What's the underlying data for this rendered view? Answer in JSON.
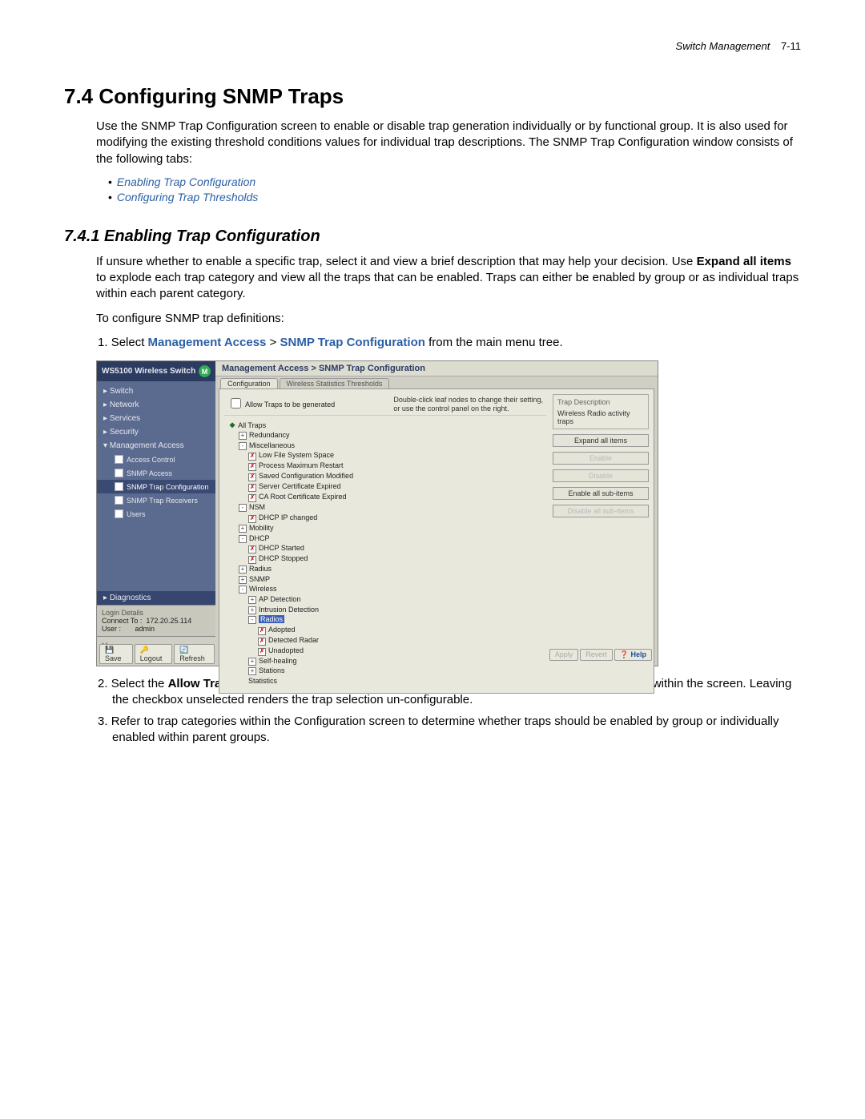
{
  "header": {
    "book": "Switch Management",
    "page": "7-11"
  },
  "section": {
    "number": "7.4",
    "title": "Configuring SNMP Traps"
  },
  "intro": "Use the SNMP Trap Configuration screen to enable or disable trap generation individually or by functional group. It is also used for modifying the existing threshold conditions values for individual trap descriptions. The SNMP Trap Configuration window consists of the following tabs:",
  "bullets": [
    "Enabling Trap Configuration",
    "Configuring Trap Thresholds"
  ],
  "subsection": {
    "number": "7.4.1",
    "title": "Enabling Trap Configuration"
  },
  "sub_intro": {
    "pre": "If unsure whether to enable a specific trap, select it and view a brief description that may help your decision. Use ",
    "emph": "Expand all items",
    "post": " to explode each trap category and view all the traps that can be enabled. Traps can either be enabled by group or as individual traps within each parent category."
  },
  "to_configure": "To configure SNMP trap definitions:",
  "steps": {
    "s1": {
      "num": "1.",
      "pre": "Select ",
      "path1": "Management Access",
      "gt": " > ",
      "path2": "SNMP Trap Configuration",
      "post": " from the main menu tree."
    },
    "s2": {
      "num": "2.",
      "pre": "Select the ",
      "emph": "Allow Traps to be generated",
      "post": " checkbox to enable the selection (and employment) of traps within the screen. Leaving the checkbox unselected renders the trap selection un-configurable."
    },
    "s3": {
      "num": "3.",
      "text": "Refer to trap categories within the Configuration screen to determine whether traps should be enabled by group or individually enabled within parent groups."
    }
  },
  "app": {
    "product": "WS5100 Wireless Switch",
    "logo_letter": "M",
    "breadcrumb": "Management Access > SNMP Trap Configuration",
    "tabs": {
      "active": "Configuration",
      "inactive": "Wireless Statistics Thresholds"
    },
    "nav": {
      "switch": "Switch",
      "network": "Network",
      "services": "Services",
      "security": "Security",
      "management": "Management Access",
      "sub": {
        "access_control": "Access Control",
        "snmp_access": "SNMP Access",
        "snmp_trap_config": "SNMP Trap Configuration",
        "snmp_trap_receivers": "SNMP Trap Receivers",
        "users": "Users"
      },
      "diagnostics": "Diagnostics"
    },
    "login": {
      "title": "Login Details",
      "connect_label": "Connect To :",
      "connect_value": "172.20.25.114",
      "user_label": "User :",
      "user_value": "admin"
    },
    "message_label": "Message",
    "toolbar": {
      "save": "Save",
      "logout": "Logout",
      "refresh": "Refresh"
    },
    "content_buttons": {
      "apply": "Apply",
      "revert": "Revert",
      "help": "Help"
    },
    "allow_traps": "Allow Traps to be generated",
    "hint1": "Double-click leaf nodes to change their setting,",
    "hint2": "or use the control panel on the right.",
    "tree": {
      "all": "All Traps",
      "redundancy": "Redundancy",
      "misc": "Miscellaneous",
      "misc_low": "Low File System Space",
      "misc_proc": "Process Maximum Restart",
      "misc_saved": "Saved Configuration Modified",
      "misc_server": "Server Certificate Expired",
      "misc_ca": "CA Root Certificate Expired",
      "nsm": "NSM",
      "nsm_dhcp": "DHCP IP changed",
      "mobility": "Mobility",
      "dhcp": "DHCP",
      "dhcp_start": "DHCP Started",
      "dhcp_stop": "DHCP Stopped",
      "radius": "Radius",
      "snmp": "SNMP",
      "wireless": "Wireless",
      "ap_detection": "AP Detection",
      "intrusion": "Intrusion Detection",
      "radios": "Radios",
      "radios_adopted": "Adopted",
      "radios_detected": "Detected Radar",
      "radios_unadopted": "Unadopted",
      "self_healing": "Self-healing",
      "stations": "Stations",
      "statistics": "Statistics"
    },
    "right": {
      "desc_title": "Trap Description",
      "desc_text": "Wireless Radio activity traps",
      "expand": "Expand all items",
      "enable": "Enable",
      "disable": "Disable",
      "enable_all": "Enable all sub-items",
      "disable_all": "Disable all sub-items"
    }
  }
}
